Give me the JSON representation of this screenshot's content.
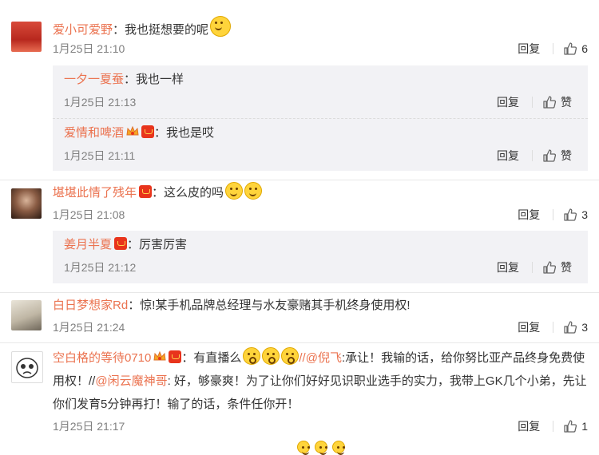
{
  "comments": [
    {
      "user": "爱小可爱野",
      "text": "：我也挺想要的呢",
      "time": "1月25日 21:10",
      "reply_label": "回复",
      "likes": "6",
      "replies": [
        {
          "user": "一夕一夏蚕",
          "text": "：我也一样",
          "time": "1月25日 21:13",
          "reply_label": "回复",
          "like_label": "赞"
        },
        {
          "user": "爱情和啤酒",
          "text": "：我也是哎",
          "time": "1月25日 21:11",
          "reply_label": "回复",
          "like_label": "赞"
        }
      ]
    },
    {
      "user": "堪堪此情了残年",
      "text": "：这么皮的吗",
      "time": "1月25日 21:08",
      "reply_label": "回复",
      "likes": "3",
      "replies": [
        {
          "user": "姜月半夏",
          "text": "：厉害厉害",
          "time": "1月25日 21:12",
          "reply_label": "回复",
          "like_label": "赞"
        }
      ]
    },
    {
      "user": "白日梦想家Rd",
      "text": "：惊!某手机品牌总经理与水友豪赌其手机终身使用权!",
      "time": "1月25日 21:24",
      "reply_label": "回复",
      "likes": "3"
    },
    {
      "user": "空白格的等待0710",
      "text_a": "：有直播么",
      "mention_1": "//@倪飞",
      "text_b": ":承让！我输的话，给你努比亚产品终身免费使用权！//",
      "mention_2": "@闲云魔神哥",
      "text_c": ": 好，够豪爽！为了让你们好好见识职业选手的实力，我带上GK几个小弟，先让你们发育5分钟再打！输了的话，条件任你开！",
      "time": "1月25日 21:17",
      "reply_label": "回复",
      "likes": "1"
    }
  ],
  "colors": {
    "username": "#eb7350",
    "reply_bg": "#f2f2f5",
    "meta": "#808080"
  }
}
